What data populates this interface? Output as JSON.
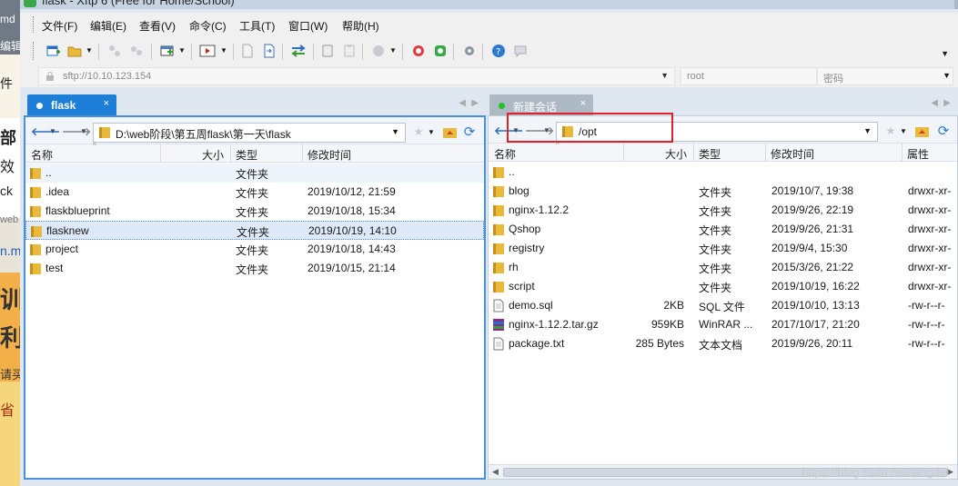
{
  "window": {
    "title": "flask - Xftp 6 (Free for Home/School)"
  },
  "left_strip_fragments": [
    "md",
    "编辑",
    "件",
    "部",
    "效",
    "ck",
    "web",
    "n.m",
    "训",
    "利",
    "请买",
    "省"
  ],
  "menu": [
    "文件(F)",
    "编辑(E)",
    "查看(V)",
    "命令(C)",
    "工具(T)",
    "窗口(W)",
    "帮助(H)"
  ],
  "toolbar_icons": [
    "new-session-icon",
    "open-folder-icon",
    "connect-icon",
    "disconnect-icon",
    "new-tab-icon",
    "refresh-remote-icon",
    "terminal-icon",
    "copy-left-icon",
    "copy-right-icon",
    "sync-icon",
    "transfer-icon",
    "paste-icon",
    "record-icon",
    "xftp-icon",
    "xshell-icon",
    "settings-icon",
    "help-icon",
    "chat-icon"
  ],
  "address": {
    "value": "sftp://10.10.123.154",
    "user_placeholder": "root",
    "pass_placeholder": "密码"
  },
  "left": {
    "tab": {
      "label": "flask",
      "close": "×"
    },
    "path": "D:\\web阶段\\第五周flask\\第一天\\flask",
    "headers": {
      "name": "名称",
      "size": "大小",
      "type": "类型",
      "mtime": "修改时间"
    },
    "rows": [
      {
        "name": "..",
        "size": "",
        "type": "文件夹",
        "mtime": ""
      },
      {
        "name": ".idea",
        "size": "",
        "type": "文件夹",
        "mtime": "2019/10/12, 21:59"
      },
      {
        "name": "flaskblueprint",
        "size": "",
        "type": "文件夹",
        "mtime": "2019/10/18, 15:34"
      },
      {
        "name": "flasknew",
        "size": "",
        "type": "文件夹",
        "mtime": "2019/10/19, 14:10"
      },
      {
        "name": "project",
        "size": "",
        "type": "文件夹",
        "mtime": "2019/10/18, 14:43"
      },
      {
        "name": "test",
        "size": "",
        "type": "文件夹",
        "mtime": "2019/10/15, 21:14"
      }
    ],
    "selected_index": 3
  },
  "right": {
    "tab": {
      "label": "新建会话",
      "close": "×"
    },
    "path": "/opt",
    "headers": {
      "name": "名称",
      "size": "大小",
      "type": "类型",
      "mtime": "修改时间",
      "attr": "属性"
    },
    "rows": [
      {
        "name": "..",
        "size": "",
        "type": "",
        "mtime": "",
        "attr": "",
        "kind": "folder"
      },
      {
        "name": "blog",
        "size": "",
        "type": "文件夹",
        "mtime": "2019/10/7, 19:38",
        "attr": "drwxr-xr-",
        "kind": "folder"
      },
      {
        "name": "nginx-1.12.2",
        "size": "",
        "type": "文件夹",
        "mtime": "2019/9/26, 22:19",
        "attr": "drwxr-xr-",
        "kind": "folder"
      },
      {
        "name": "Qshop",
        "size": "",
        "type": "文件夹",
        "mtime": "2019/9/26, 21:31",
        "attr": "drwxr-xr-",
        "kind": "folder"
      },
      {
        "name": "registry",
        "size": "",
        "type": "文件夹",
        "mtime": "2019/9/4, 15:30",
        "attr": "drwxr-xr-",
        "kind": "folder"
      },
      {
        "name": "rh",
        "size": "",
        "type": "文件夹",
        "mtime": "2015/3/26, 21:22",
        "attr": "drwxr-xr-",
        "kind": "folder"
      },
      {
        "name": "script",
        "size": "",
        "type": "文件夹",
        "mtime": "2019/10/19, 16:22",
        "attr": "drwxr-xr-",
        "kind": "folder"
      },
      {
        "name": "demo.sql",
        "size": "2KB",
        "type": "SQL 文件",
        "mtime": "2019/10/10, 13:13",
        "attr": "-rw-r--r-",
        "kind": "file"
      },
      {
        "name": "nginx-1.12.2.tar.gz",
        "size": "959KB",
        "type": "WinRAR ...",
        "mtime": "2017/10/17, 21:20",
        "attr": "-rw-r--r-",
        "kind": "archive"
      },
      {
        "name": "package.txt",
        "size": "285 Bytes",
        "type": "文本文档",
        "mtime": "2019/9/26, 20:11",
        "attr": "-rw-r--r-",
        "kind": "file"
      }
    ]
  },
  "watermark": "https://blog.csdn.net/langdei",
  "colors": {
    "accent": "#1e7fd8",
    "highlight": "#e0202a",
    "folder": "#e8b93a"
  }
}
